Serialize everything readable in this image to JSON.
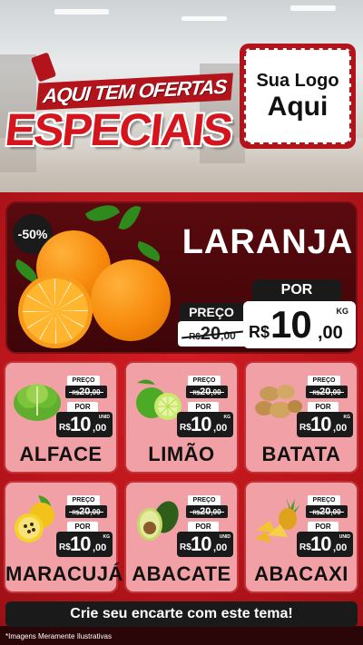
{
  "header": {
    "title_top": "AQUI TEM OFERTAS",
    "title_main": "ESPECIAIS",
    "logo_line1": "Sua Logo",
    "logo_line2": "Aqui"
  },
  "featured": {
    "discount": "-50%",
    "name": "LARANJA",
    "preco_label": "PREÇO",
    "old_currency": "R$",
    "old_value": "20",
    "old_cents": ",00",
    "por_label": "POR",
    "new_currency": "R$",
    "new_value": "10",
    "new_cents": ",00",
    "unit": "KG"
  },
  "products": [
    {
      "name": "ALFACE",
      "preco_label": "PREÇO",
      "old_currency": "R$",
      "old_value": "20",
      "old_cents": ",00",
      "por_label": "POR",
      "new_currency": "R$",
      "new_value": "10",
      "new_cents": ",00",
      "unit": "UNID",
      "icon": "lettuce-icon"
    },
    {
      "name": "LIMÃO",
      "preco_label": "PREÇO",
      "old_currency": "R$",
      "old_value": "20",
      "old_cents": ",00",
      "por_label": "POR",
      "new_currency": "R$",
      "new_value": "10",
      "new_cents": ",00",
      "unit": "KG",
      "icon": "lime-icon"
    },
    {
      "name": "BATATA",
      "preco_label": "PREÇO",
      "old_currency": "R$",
      "old_value": "20",
      "old_cents": ",00",
      "por_label": "POR",
      "new_currency": "R$",
      "new_value": "10",
      "new_cents": ",00",
      "unit": "KG",
      "icon": "potato-icon"
    },
    {
      "name": "MARACUJÁ",
      "preco_label": "PREÇO",
      "old_currency": "R$",
      "old_value": "20",
      "old_cents": ",00",
      "por_label": "POR",
      "new_currency": "R$",
      "new_value": "10",
      "new_cents": ",00",
      "unit": "KG",
      "icon": "passion-fruit-icon"
    },
    {
      "name": "ABACATE",
      "preco_label": "PREÇO",
      "old_currency": "R$",
      "old_value": "20",
      "old_cents": ",00",
      "por_label": "POR",
      "new_currency": "R$",
      "new_value": "10",
      "new_cents": ",00",
      "unit": "UNID",
      "icon": "avocado-icon"
    },
    {
      "name": "ABACAXI",
      "preco_label": "PREÇO",
      "old_currency": "R$",
      "old_value": "20",
      "old_cents": ",00",
      "por_label": "POR",
      "new_currency": "R$",
      "new_value": "10",
      "new_cents": ",00",
      "unit": "UNID",
      "icon": "pineapple-icon"
    }
  ],
  "cta": "Crie seu encarte com este tema!",
  "footer_note": "*Imagens Meramente Ilustrativas",
  "colors": {
    "brand_red": "#d4151e",
    "dark": "#1a1a1a",
    "card_pink": "#f1a1a6"
  }
}
